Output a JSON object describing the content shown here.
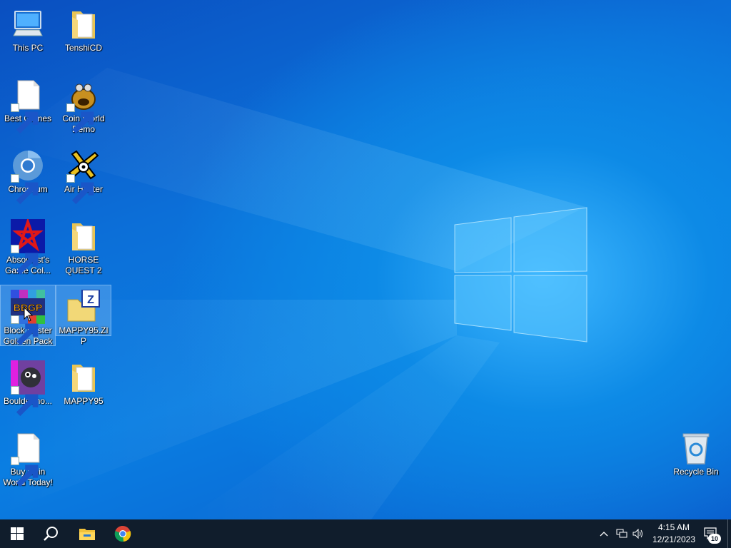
{
  "desktop": {
    "icons": {
      "this_pc": "This PC",
      "tenshicd": "TenshiCD",
      "best_games": "Best Games",
      "coin_world_demo": "Coin World Demo",
      "chromium": "Chromium",
      "air_hunter": "Air Hunter",
      "absolutist": "Absolutist's Game Col...",
      "horse_quest": "HORSE QUEST 2",
      "block_buster": "Block Buster Golden Pack",
      "mappy95_zip": "MAPPY95.ZIP",
      "bouldermo": "Bouldermo...",
      "mappy95": "MAPPY95",
      "buy_coin_world": "Buy Coin World Today!",
      "recycle_bin": "Recycle Bin"
    },
    "block_buster_logo_text": "BBGP",
    "zip_letter": "Z"
  },
  "taskbar": {
    "clock_time": "4:15 AM",
    "clock_date": "12/21/2023",
    "notification_count": "10"
  },
  "colors": {
    "taskbar_bg": "#101d2c",
    "desktop_accent": "#0a7ee2"
  }
}
